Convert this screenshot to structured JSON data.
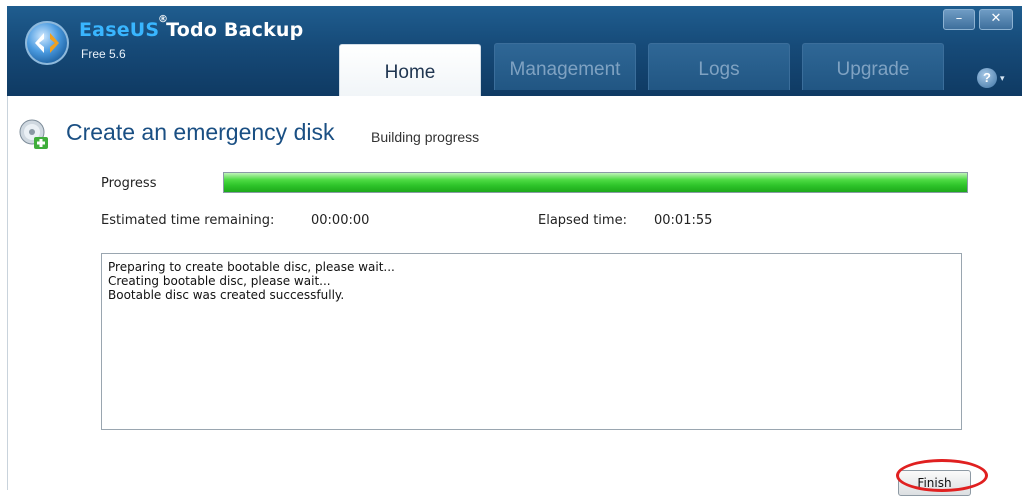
{
  "app": {
    "brand": "EaseUS",
    "reg_mark": "®",
    "product": "Todo Backup",
    "version": "Free 5.6"
  },
  "window_controls": {
    "minimize": "–",
    "close": "✕"
  },
  "help": {
    "label": "?",
    "caret": "▾"
  },
  "tabs": [
    {
      "label": "Home",
      "active": true
    },
    {
      "label": "Management",
      "active": false
    },
    {
      "label": "Logs",
      "active": false
    },
    {
      "label": "Upgrade",
      "active": false
    }
  ],
  "page": {
    "title": "Create an emergency disk",
    "subtitle": "Building progress"
  },
  "progress": {
    "label": "Progress",
    "fraction": 1.0,
    "estimated_label": "Estimated time remaining:",
    "estimated_value": "00:00:00",
    "elapsed_label": "Elapsed time:",
    "elapsed_value": "00:01:55"
  },
  "log": {
    "lines": [
      "Preparing to create bootable disc, please wait...",
      "Creating bootable disc, please wait...",
      "Bootable disc was created successfully."
    ]
  },
  "buttons": {
    "finish_first": "F",
    "finish_rest": "inish"
  },
  "colors": {
    "titlebar": "#164a78",
    "accent_title": "#1a4f83",
    "progress_green": "#2ec42a",
    "highlight_ring": "#e02020"
  },
  "icons": {
    "app_logo": "easeus-logo-icon",
    "page_icon": "emergency-disk-icon"
  }
}
